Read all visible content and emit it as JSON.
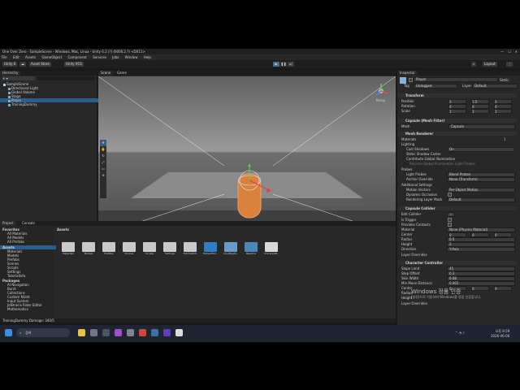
{
  "window": {
    "title": "One Over Zero - SampleScene - Windows, Mac, Linux - Unity 6.2 (?) (6000.2.?) <DX11>"
  },
  "menu": [
    "File",
    "Edit",
    "Assets",
    "GameObject",
    "Component",
    "Services",
    "Jobs",
    "Window",
    "Help"
  ],
  "toolbar": {
    "account": "Unity 6",
    "asset_store": "Asset Store",
    "vcs": "Unity VCS",
    "layout": "Layout"
  },
  "hierarchy": {
    "tab": "Hierarchy",
    "items": [
      "SampleScene",
      "Directional Light",
      "Global Volume",
      "Stage",
      "Player",
      "TrainingDummy"
    ]
  },
  "scene_view": {
    "tabs": [
      "Scene",
      "Game"
    ],
    "persp": "Persp"
  },
  "project": {
    "tabs": [
      "Project",
      "Console"
    ],
    "favorites_title": "Favorites",
    "favorites": [
      "All Materials",
      "All Models",
      "All Prefabs"
    ],
    "assets_title": "Assets",
    "assets_tree": [
      "Materials",
      "Models",
      "Prefabs",
      "Scenes",
      "Scripts",
      "Settings",
      "TutorialInfo"
    ],
    "packages_title": "Packages",
    "packages": [
      "AI Navigation",
      "Burst",
      "Collections",
      "Custom NUnit",
      "Input System",
      "JetBrains Rider Editor",
      "Mathematics"
    ],
    "breadcrumb": "Assets",
    "grid_items": [
      "Materials",
      "Models",
      "Prefabs",
      "Scenes",
      "Scripts",
      "Settings",
      "TutorialInfo",
      "DefaultVol...",
      "InputSyste...",
      "Readme",
      "UniversalR..."
    ],
    "status": "TrainingDummy Damage: 340/5"
  },
  "inspector": {
    "tab": "Inspector",
    "object_name": "Player",
    "static_label": "Static",
    "tag_label": "Tag",
    "tag": "Untagged",
    "layer_label": "Layer",
    "layer": "Default",
    "transform": {
      "title": "Transform",
      "position_label": "Position",
      "rotation_label": "Rotation",
      "scale_label": "Scale",
      "position": [
        "0",
        "1.5",
        "0"
      ],
      "rotation": [
        "0",
        "0",
        "0"
      ],
      "scale": [
        "1",
        "1",
        "1"
      ]
    },
    "mesh_filter": {
      "title": "Capsule (Mesh Filter)",
      "mesh_label": "Mesh",
      "mesh": "Capsule"
    },
    "mesh_renderer": {
      "title": "Mesh Renderer",
      "materials": "Materials",
      "materials_count": "1",
      "lighting": "Lighting",
      "cast_shadows_label": "Cast Shadows",
      "cast_shadows": "On",
      "static_shadow_caster": "Static Shadow Caster",
      "contribute_gi": "Contribute Global Illumination",
      "receive_gi_label": "Receive Global Illumination",
      "receive_gi": "Light Probes",
      "probes": "Probes",
      "light_probes_label": "Light Probes",
      "light_probes": "Blend Probes",
      "anchor_label": "Anchor Override",
      "anchor": "None (Transform)",
      "additional": "Additional Settings",
      "motion_vectors_label": "Motion Vectors",
      "motion_vectors": "Per Object Motion",
      "dynamic_occlusion": "Dynamic Occlusion",
      "rendering_layer_label": "Rendering Layer Mask",
      "rendering_layer": "Default"
    },
    "capsule_collider": {
      "title": "Capsule Collider",
      "edit_collider": "Edit Collider",
      "is_trigger": "Is Trigger",
      "provides_contacts": "Provides Contacts",
      "material_label": "Material",
      "material": "None (Physics Material)",
      "center_label": "Center",
      "center": [
        "0",
        "0",
        "0"
      ],
      "radius_label": "Radius",
      "radius": "0.5",
      "height_label": "Height",
      "height": "2",
      "direction_label": "Direction",
      "direction": "Y-Axis",
      "layer_overrides": "Layer Overrides"
    },
    "character_controller": {
      "title": "Character Controller",
      "slope_label": "Slope Limit",
      "slope": "45",
      "step_label": "Step Offset",
      "step": "0.3",
      "skin_label": "Skin Width",
      "skin": "0.08",
      "min_move_label": "Min Move Distance",
      "min_move": "0.001",
      "center_label": "Center",
      "center": [
        "0",
        "0",
        "0"
      ],
      "radius_label": "Radius",
      "height_label": "Height",
      "layer_overrides": "Layer Overrides"
    },
    "watermark_line1": "Windows 정품 인증",
    "watermark_line2": "[설정]으로 이동하여 Windows를 정품 인증합니다."
  },
  "taskbar": {
    "search": "검색",
    "time": "오후 8:59",
    "date": "2026-06-06"
  }
}
